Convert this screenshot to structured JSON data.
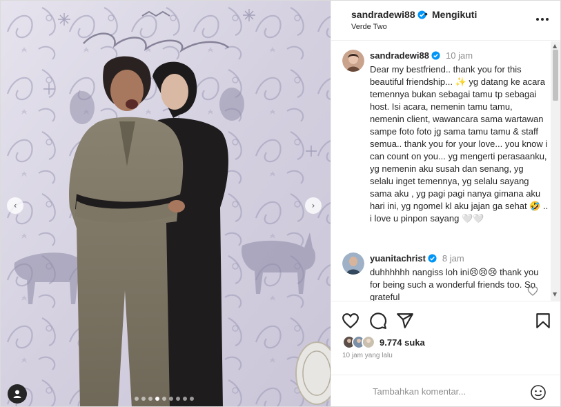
{
  "post": {
    "username": "sandradewi88",
    "separator": "•",
    "follow_status": "Mengikuti",
    "audio": "Verde Two",
    "caption_user": "sandradewi88",
    "caption_time": "10 jam",
    "caption": "Dear my bestfriend.. thank you for this beautiful friendship... ✨ yg datang ke acara temennya bukan sebagai tamu tp sebagai host. Isi acara, nemenin tamu tamu, nemenin client, wawancara sama wartawan sampe foto foto jg sama tamu tamu & staff semua.. thank you for your love... you know i can count on you... yg mengerti perasaanku, yg nemenin aku susah dan senang, yg selalu inget temennya, yg selalu sayang sama aku , yg pagi pagi nanya gimana aku hari ini, yg ngomel kl aku jajan ga sehat 🤣 .. i love u pinpon sayang 🤍🤍"
  },
  "comments": [
    {
      "username": "yuanitachrist",
      "time": "8 jam",
      "text": "duhhhhhh nangiss loh ini😢😢😢 thank you for being such a wonderful friends too. So grateful"
    }
  ],
  "stats": {
    "likes": "9.774 suka",
    "posted": "10 jam yang lalu"
  },
  "comment_input": {
    "placeholder": "Tambahkan komentar..."
  },
  "media": {
    "slide_count": 9,
    "active_slide": 4,
    "nav_prev": "‹",
    "nav_next": "›"
  },
  "icons": {
    "like": "heart-outline-icon",
    "comment": "speech-bubble-icon",
    "share": "paper-plane-icon",
    "save": "bookmark-icon",
    "more": "more-horizontal-icon",
    "emoji": "smiley-icon",
    "verified": "verified-badge-icon",
    "tag": "user-tag-icon"
  },
  "colors": {
    "text": "#262626",
    "muted": "#8e8e8e",
    "verified": "#0095f6",
    "border": "#efefef"
  }
}
